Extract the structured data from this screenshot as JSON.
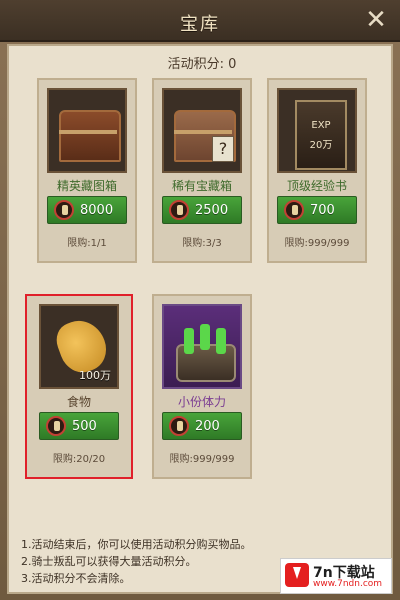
{
  "header": {
    "title": "宝库",
    "close_icon": "✕"
  },
  "points": {
    "label": "活动积分: 0"
  },
  "items": [
    {
      "name": "精英藏图箱",
      "price": "8000",
      "limit": "限购:1/1"
    },
    {
      "name": "稀有宝藏箱",
      "price": "2500",
      "limit": "限购:3/3"
    },
    {
      "name": "顶级经验书",
      "price": "700",
      "limit": "限购:999/999",
      "badge_top": "EXP",
      "badge_bottom": "20万"
    },
    {
      "name": "食物",
      "price": "500",
      "limit": "限购:20/20",
      "qty": "100万"
    },
    {
      "name": "小份体力",
      "price": "200",
      "limit": "限购:999/999"
    }
  ],
  "notes": [
    "1.活动结束后，你可以使用活动积分购买物品。",
    "2.骑士叛乱可以获得大量活动积分。",
    "3.活动积分不会清除。"
  ],
  "watermark": {
    "brand": "7n下载站",
    "url": "www.7ndn.com"
  },
  "colors": {
    "green_button": "#2f7a26",
    "selected_border": "#e0202a",
    "panel_bg": "#e9e0cd"
  }
}
